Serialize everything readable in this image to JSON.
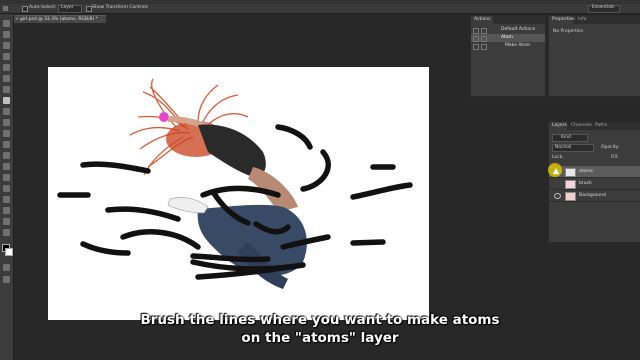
{
  "options_bar": {
    "auto_select_label": "Auto-Select:",
    "auto_select_value": "Layer",
    "transform_label": "Show Transform Controls",
    "workspace_label": "Essentials"
  },
  "document": {
    "tab_title": "girl.psd @ 33.3% (atoms, RGB/8) *"
  },
  "actions_panel": {
    "tab": "Actions",
    "items": [
      {
        "label": "Default Actions"
      },
      {
        "label": "Atom"
      },
      {
        "label": "Make Atom"
      }
    ]
  },
  "properties_panel": {
    "tabs": [
      "Properties",
      "Info"
    ],
    "content": "No Properties"
  },
  "layers_panel": {
    "tabs": [
      "Layers",
      "Channels",
      "Paths"
    ],
    "filter_kind": "Kind",
    "blend_mode": "Normal",
    "opacity_label": "Opacity:",
    "lock_label": "Lock:",
    "fill_label": "Fill:",
    "layers": [
      {
        "name": "atoms",
        "selected": true
      },
      {
        "name": "brush",
        "selected": false
      },
      {
        "name": "Background",
        "selected": false
      }
    ]
  },
  "caption": {
    "line1": "Brush the lines where you want to make atoms",
    "line2": "on the \"atoms\" layer"
  },
  "colors": {
    "background": "#282828",
    "panel": "#3c3c3c",
    "selected_layer": "#5c5c5c",
    "brush_stroke": "#111111",
    "hair": "#d84a20",
    "cursor": "#d6c000"
  }
}
